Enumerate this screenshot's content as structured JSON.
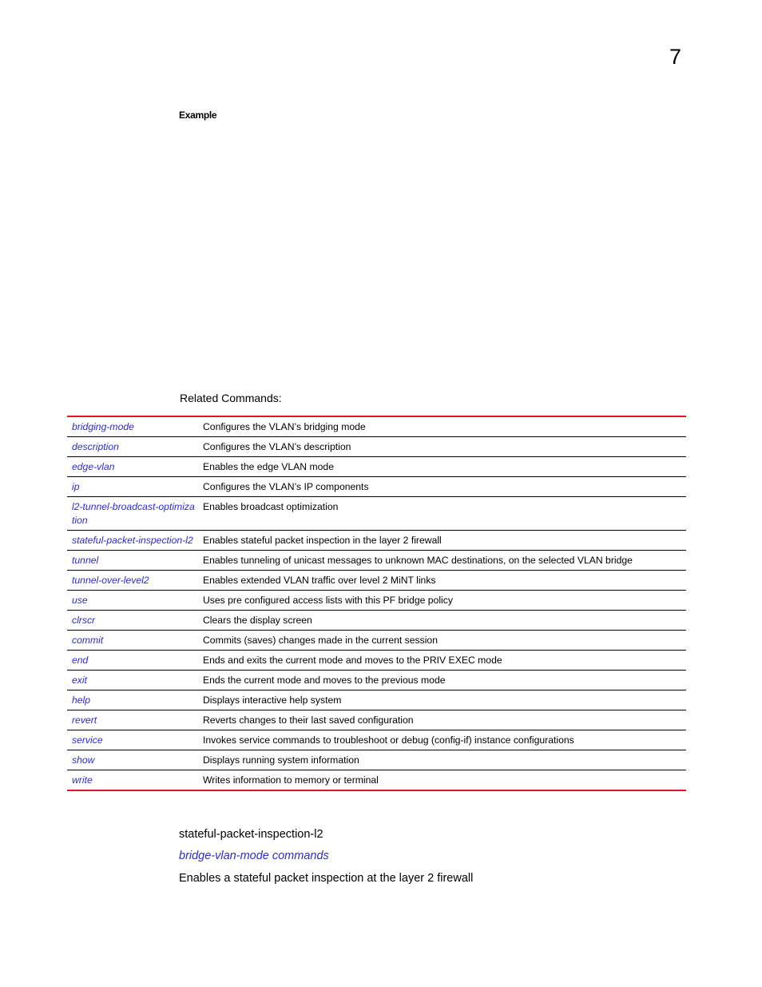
{
  "page": {
    "chapter_number": "7",
    "example_label": "Example",
    "related_commands_heading": "Related Commands:"
  },
  "colors": {
    "rule_red": "#e8112d",
    "link_blue": "#2b2bd8"
  },
  "related_commands": [
    {
      "command": "bridging-mode",
      "description": "Configures the VLAN’s bridging mode"
    },
    {
      "command": "description",
      "description": "Configures the VLAN’s description"
    },
    {
      "command": "edge-vlan",
      "description": "Enables the edge VLAN mode"
    },
    {
      "command": "ip",
      "description": "Configures the VLAN’s IP components"
    },
    {
      "command": "l2-tunnel-broadcast-optimization",
      "description": "Enables broadcast optimization"
    },
    {
      "command": "stateful-packet-inspection-l2",
      "description": "Enables stateful packet inspection in the layer 2 firewall"
    },
    {
      "command": "tunnel",
      "description": "Enables tunneling of unicast messages to unknown MAC destinations, on the selected VLAN bridge"
    },
    {
      "command": "tunnel-over-level2",
      "description": "Enables extended VLAN traffic over level 2 MiNT links"
    },
    {
      "command": "use",
      "description": "Uses pre configured access lists with this PF bridge policy"
    },
    {
      "command": "clrscr",
      "description": "Clears the display screen"
    },
    {
      "command": "commit",
      "description": "Commits (saves) changes made in the current session"
    },
    {
      "command": "end",
      "description": "Ends and exits the current mode and moves to the PRIV EXEC mode"
    },
    {
      "command": "exit",
      "description": "Ends the current mode and moves to the previous mode"
    },
    {
      "command": "help",
      "description": "Displays interactive help system"
    },
    {
      "command": "revert",
      "description": "Reverts changes to their last saved configuration"
    },
    {
      "command": "service",
      "description": "Invokes service commands to troubleshoot or debug (config-if) instance configurations"
    },
    {
      "command": "show",
      "description": "Displays running system information"
    },
    {
      "command": "write",
      "description": "Writes information to memory or terminal"
    }
  ],
  "section": {
    "title": "stateful-packet-inspection-l2",
    "link": "bridge-vlan-mode commands",
    "description": "Enables a stateful packet inspection at the layer 2 firewall"
  }
}
